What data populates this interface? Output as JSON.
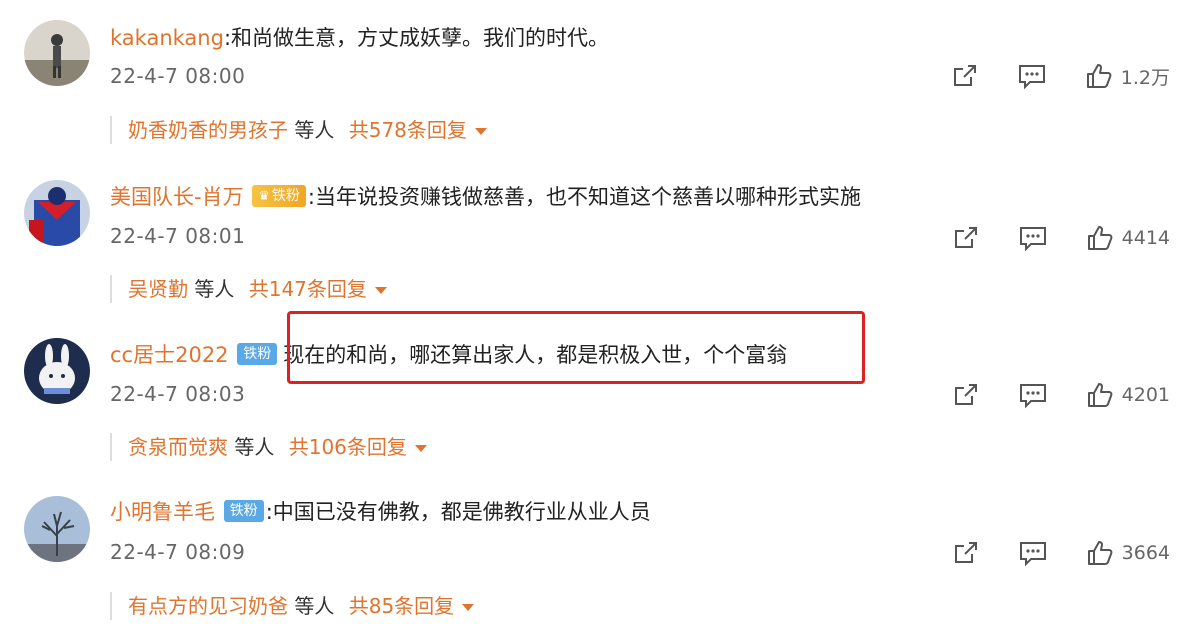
{
  "comments": [
    {
      "username": "kakankang",
      "badge": "",
      "separator": ":",
      "text": "和尚做生意，方丈成妖孽。我们的时代。",
      "time": "22-4-7 08:00",
      "likes": "1.2万",
      "reply_user": "奶香奶香的男孩子",
      "reply_mid": "等人",
      "reply_total": "共578条回复"
    },
    {
      "username": "美国队长-肖万",
      "badge": "铁粉",
      "separator": ":",
      "text": "当年说投资赚钱做慈善，也不知道这个慈善以哪种形式实施",
      "time": "22-4-7 08:01",
      "likes": "4414",
      "reply_user": "吴贤勤",
      "reply_mid": "等人",
      "reply_total": "共147条回复"
    },
    {
      "username": "cc居士2022",
      "badge": "铁粉",
      "separator": "",
      "text": "现在的和尚，哪还算出家人，都是积极入世，个个富翁",
      "time": "22-4-7 08:03",
      "likes": "4201",
      "reply_user": "贪泉而觉爽",
      "reply_mid": "等人",
      "reply_total": "共106条回复"
    },
    {
      "username": "小明鲁羊毛",
      "badge": "铁粉",
      "separator": ":",
      "text": "中国已没有佛教，都是佛教行业从业人员",
      "time": "22-4-7 08:09",
      "likes": "3664",
      "reply_user": "有点方的见习奶爸",
      "reply_mid": "等人",
      "reply_total": "共85条回复"
    }
  ],
  "icons": {
    "share": "share-icon",
    "comment": "comment-icon",
    "like": "like-icon",
    "dropdown": "caret-down-icon"
  },
  "colors": {
    "username": "#e0742e",
    "badge_blue": "#5aa9e6",
    "badge_gold": "#f2a524",
    "highlight_border": "#e02020"
  }
}
